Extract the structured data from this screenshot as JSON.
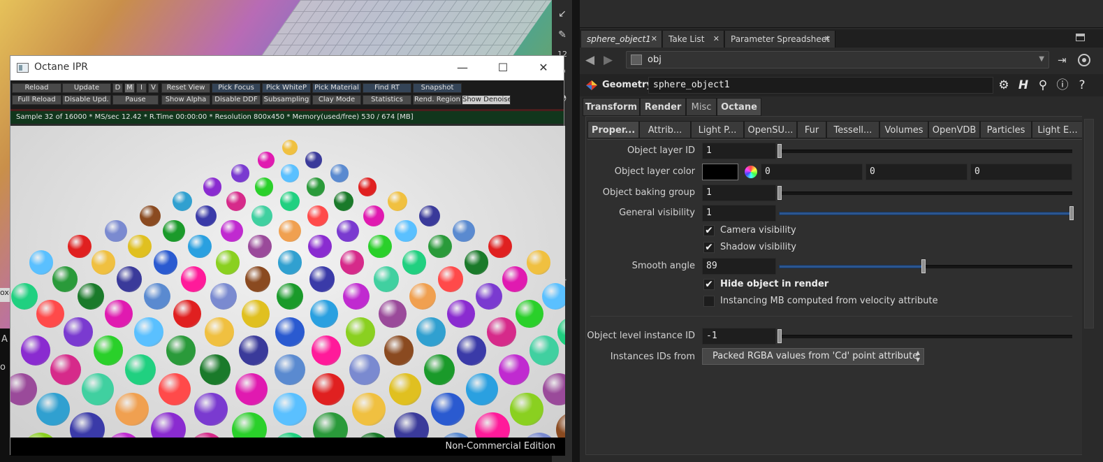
{
  "octane": {
    "title": "Octane IPR",
    "window_controls": {
      "minimize": "—",
      "maximize": "☐",
      "close": "✕"
    },
    "toolbar_row1": [
      "Reload",
      "Update",
      "D",
      "M",
      "I",
      "V",
      "Reset View",
      "Pick Focus",
      "Pick WhiteP",
      "Pick Material",
      "Find RT",
      "Snapshot"
    ],
    "toolbar_row2": [
      "Full Reload",
      "Disable Upd.",
      "Pause",
      "Show Alpha",
      "Disable DDF",
      "Subsampling",
      "Clay Mode",
      "Statistics",
      "Rend. Region",
      "Show Denoise"
    ],
    "status": "Sample 32 of 16000 * MS/sec 12.42 * R.Time 00:00:00 * Resolution 800x450 * Memory(used/free) 530 / 674 [MB]",
    "footer": "Non-Commercial Edition",
    "sphere_colors": [
      "#f0c040",
      "#8a4a20",
      "#8a2bd0",
      "#2a9a3a",
      "#ff1a9a",
      "#3a3aa8",
      "#7a3ad0",
      "#3a3a9a",
      "#1a9a2a",
      "#d62a8a",
      "#1a7a2a",
      "#7a8ad0",
      "#c02ad0",
      "#2ad02a",
      "#5a8ad0",
      "#2aa0e0",
      "#40d0a0",
      "#e01ab0",
      "#e0c020",
      "#9a4a9a",
      "#20d080",
      "#e02020",
      "#8ad020",
      "#f0a050",
      "#5ac0ff",
      "#2a5ad0",
      "#30a0d0",
      "#ff4a4a"
    ]
  },
  "panel": {
    "tabs": [
      {
        "label": "sphere_object1",
        "close": "✕"
      },
      {
        "label": "Take List",
        "close": "✕"
      },
      {
        "label": "Parameter Spreadsheet",
        "close": "✕"
      }
    ],
    "add_tab": "+",
    "path": "obj",
    "geometry_label": "Geometry",
    "geometry_name": "sphere_object1",
    "main_tabs": [
      "Transform",
      "Render",
      "Misc",
      "Octane"
    ],
    "sub_tabs": [
      "Proper...",
      "Attrib...",
      "Light P...",
      "OpenSU...",
      "Fur",
      "Tessell...",
      "Volumes",
      "OpenVDB",
      "Particles",
      "Light E..."
    ],
    "params": {
      "object_layer_id": {
        "label": "Object layer ID",
        "value": "1"
      },
      "object_layer_color": {
        "label": "Object layer color",
        "r": "0",
        "g": "0",
        "b": "0",
        "swatch": "#000000"
      },
      "object_baking_group": {
        "label": "Object baking group",
        "value": "1"
      },
      "general_visibility": {
        "label": "General visibility",
        "value": "1",
        "fraction": 1.0
      },
      "camera_visibility": {
        "label": "Camera visibility",
        "checked": true
      },
      "shadow_visibility": {
        "label": "Shadow visibility",
        "checked": true
      },
      "smooth_angle": {
        "label": "Smooth angle",
        "value": "89",
        "fraction": 0.494
      },
      "hide_object_in_render": {
        "label": "Hide object in render",
        "checked": true
      },
      "instancing_mb": {
        "label": "Instancing MB computed from velocity attribute",
        "checked": false
      },
      "object_level_instance_id": {
        "label": "Object level instance ID",
        "value": "-1"
      },
      "instances_ids_from": {
        "label": "Instances IDs from",
        "value": "Packed RGBA values from 'Cd' point attribute"
      }
    },
    "checkmark": "✔"
  },
  "viewport": {
    "fragment_a": "A",
    "fragment_b": "o",
    "fragment_c": "ox-"
  }
}
